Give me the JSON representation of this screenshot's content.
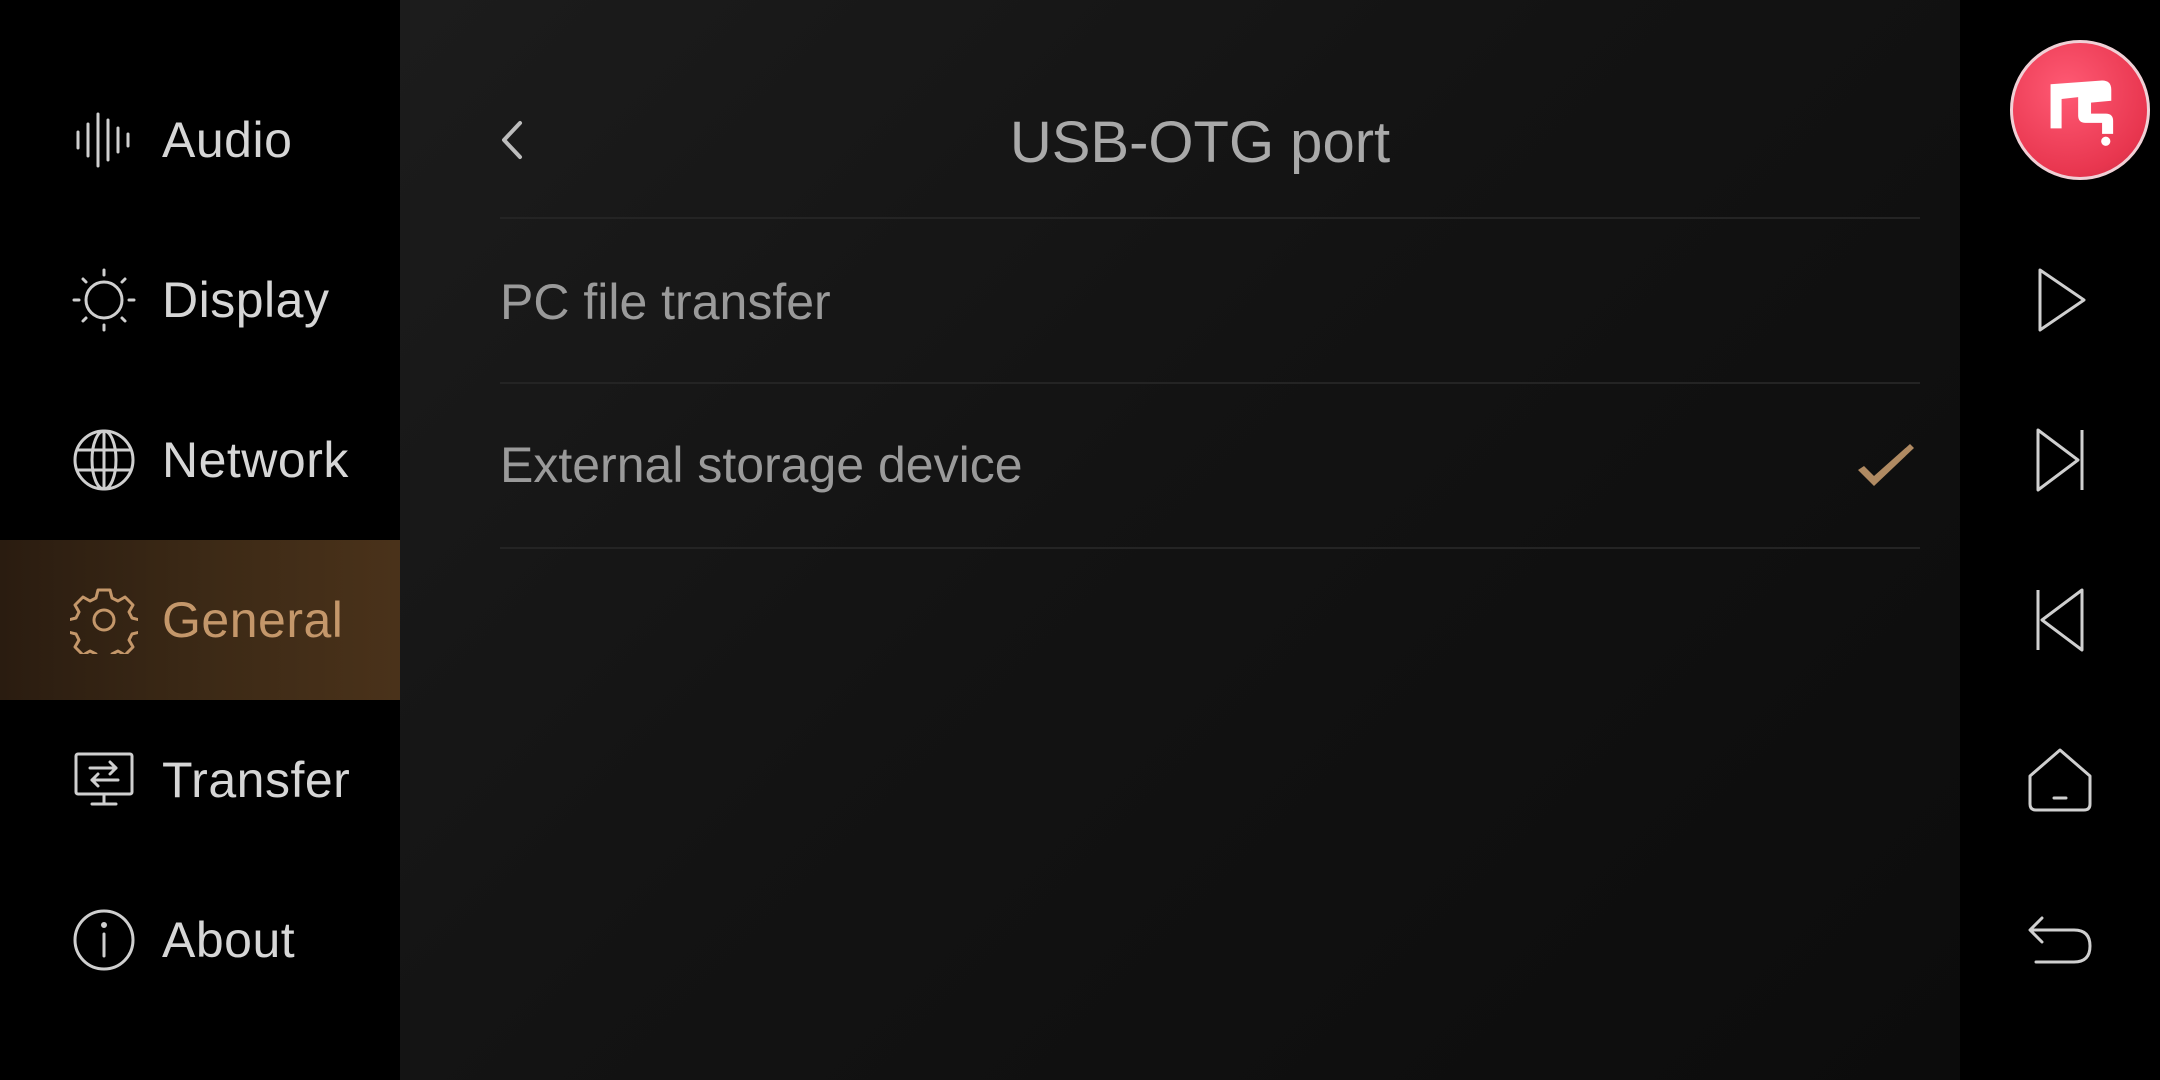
{
  "sidebar": {
    "items": [
      {
        "label": "Audio"
      },
      {
        "label": "Display"
      },
      {
        "label": "Network"
      },
      {
        "label": "General"
      },
      {
        "label": "Transfer"
      },
      {
        "label": "About"
      }
    ],
    "active_index": 3
  },
  "header": {
    "title": "USB-OTG port"
  },
  "options": [
    {
      "label": "PC file transfer",
      "selected": false
    },
    {
      "label": "External storage device",
      "selected": true
    }
  ],
  "controls": {
    "items": [
      "play-icon",
      "next-track-icon",
      "previous-track-icon",
      "home-icon",
      "back-icon"
    ]
  },
  "colors": {
    "accent": "#c4976a",
    "logo": "#e8364f"
  }
}
